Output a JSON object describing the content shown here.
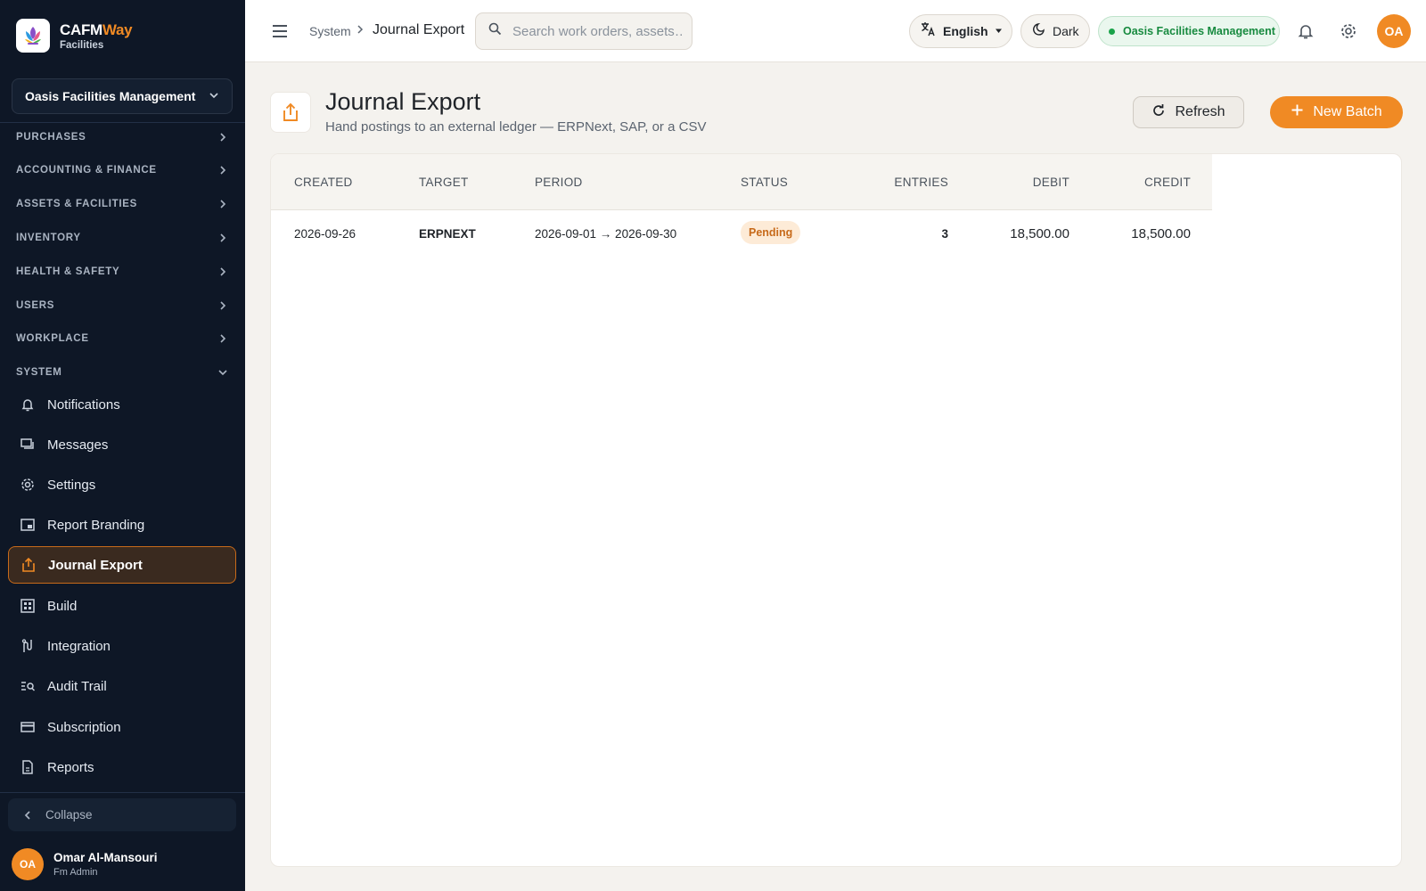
{
  "brand": {
    "name_part1": "CAFM",
    "name_part2": "Way",
    "subtitle": "Facilities"
  },
  "sidebar": {
    "org_selector": "Oasis Facilities Management",
    "sections": [
      {
        "label": "PURCHASES",
        "expanded": false
      },
      {
        "label": "ACCOUNTING & FINANCE",
        "expanded": false
      },
      {
        "label": "ASSETS & FACILITIES",
        "expanded": false
      },
      {
        "label": "INVENTORY",
        "expanded": false
      },
      {
        "label": "HEALTH & SAFETY",
        "expanded": false
      },
      {
        "label": "USERS",
        "expanded": false
      },
      {
        "label": "WORKPLACE",
        "expanded": false
      },
      {
        "label": "SYSTEM",
        "expanded": true
      }
    ],
    "items": [
      {
        "label": "Notifications",
        "icon": "bell-icon"
      },
      {
        "label": "Messages",
        "icon": "messages-icon"
      },
      {
        "label": "Settings",
        "icon": "gear-icon"
      },
      {
        "label": "Report Branding",
        "icon": "branding-icon"
      },
      {
        "label": "Journal Export",
        "icon": "export-icon",
        "active": true
      },
      {
        "label": "Build",
        "icon": "build-icon"
      },
      {
        "label": "Integration",
        "icon": "integration-icon"
      },
      {
        "label": "Audit Trail",
        "icon": "audit-icon"
      },
      {
        "label": "Subscription",
        "icon": "card-icon"
      },
      {
        "label": "Reports",
        "icon": "reports-icon"
      }
    ],
    "collapse_label": "Collapse",
    "user": {
      "initials": "OA",
      "name": "Omar Al-Mansouri",
      "role": "Fm Admin"
    }
  },
  "topbar": {
    "breadcrumb_parent": "System",
    "breadcrumb_current": "Journal Export",
    "search_placeholder": "Search work orders, assets…",
    "language": "English",
    "theme": "Dark",
    "org_badge": "Oasis Facilities Management",
    "avatar_initials": "OA"
  },
  "page": {
    "title": "Journal Export",
    "subtitle": "Hand postings to an external ledger — ERPNext, SAP, or a CSV",
    "refresh_label": "Refresh",
    "new_batch_label": "New Batch"
  },
  "table": {
    "columns": [
      "CREATED",
      "TARGET",
      "PERIOD",
      "STATUS",
      "ENTRIES",
      "DEBIT",
      "CREDIT"
    ],
    "rows": [
      {
        "created": "2026-09-26",
        "target": "ERPNEXT",
        "period": "2026-09-01 → 2026-09-30",
        "status": "Pending",
        "entries": "3",
        "debit": "18,500.00",
        "credit": "18,500.00"
      }
    ]
  },
  "colors": {
    "accent": "#f08a24",
    "sidebar_bg": "#0e1726",
    "success": "#1aa34a"
  }
}
